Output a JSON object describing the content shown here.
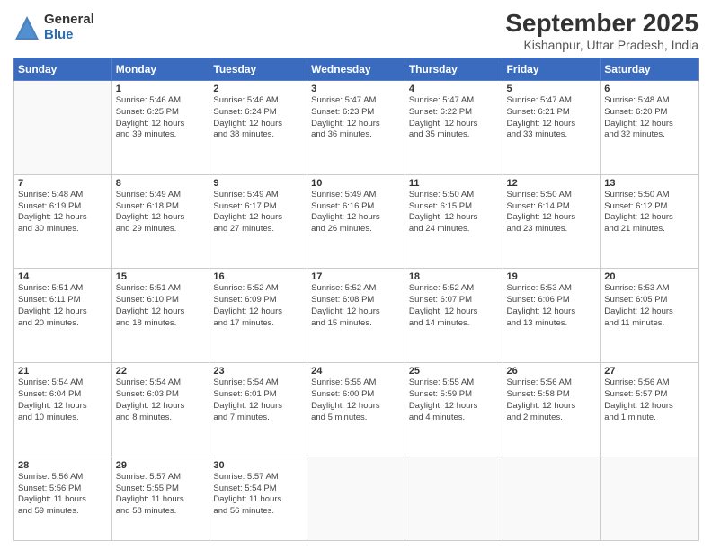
{
  "logo": {
    "general": "General",
    "blue": "Blue"
  },
  "header": {
    "title": "September 2025",
    "subtitle": "Kishanpur, Uttar Pradesh, India"
  },
  "weekdays": [
    "Sunday",
    "Monday",
    "Tuesday",
    "Wednesday",
    "Thursday",
    "Friday",
    "Saturday"
  ],
  "weeks": [
    [
      {
        "day": "",
        "info": ""
      },
      {
        "day": "1",
        "info": "Sunrise: 5:46 AM\nSunset: 6:25 PM\nDaylight: 12 hours\nand 39 minutes."
      },
      {
        "day": "2",
        "info": "Sunrise: 5:46 AM\nSunset: 6:24 PM\nDaylight: 12 hours\nand 38 minutes."
      },
      {
        "day": "3",
        "info": "Sunrise: 5:47 AM\nSunset: 6:23 PM\nDaylight: 12 hours\nand 36 minutes."
      },
      {
        "day": "4",
        "info": "Sunrise: 5:47 AM\nSunset: 6:22 PM\nDaylight: 12 hours\nand 35 minutes."
      },
      {
        "day": "5",
        "info": "Sunrise: 5:47 AM\nSunset: 6:21 PM\nDaylight: 12 hours\nand 33 minutes."
      },
      {
        "day": "6",
        "info": "Sunrise: 5:48 AM\nSunset: 6:20 PM\nDaylight: 12 hours\nand 32 minutes."
      }
    ],
    [
      {
        "day": "7",
        "info": "Sunrise: 5:48 AM\nSunset: 6:19 PM\nDaylight: 12 hours\nand 30 minutes."
      },
      {
        "day": "8",
        "info": "Sunrise: 5:49 AM\nSunset: 6:18 PM\nDaylight: 12 hours\nand 29 minutes."
      },
      {
        "day": "9",
        "info": "Sunrise: 5:49 AM\nSunset: 6:17 PM\nDaylight: 12 hours\nand 27 minutes."
      },
      {
        "day": "10",
        "info": "Sunrise: 5:49 AM\nSunset: 6:16 PM\nDaylight: 12 hours\nand 26 minutes."
      },
      {
        "day": "11",
        "info": "Sunrise: 5:50 AM\nSunset: 6:15 PM\nDaylight: 12 hours\nand 24 minutes."
      },
      {
        "day": "12",
        "info": "Sunrise: 5:50 AM\nSunset: 6:14 PM\nDaylight: 12 hours\nand 23 minutes."
      },
      {
        "day": "13",
        "info": "Sunrise: 5:50 AM\nSunset: 6:12 PM\nDaylight: 12 hours\nand 21 minutes."
      }
    ],
    [
      {
        "day": "14",
        "info": "Sunrise: 5:51 AM\nSunset: 6:11 PM\nDaylight: 12 hours\nand 20 minutes."
      },
      {
        "day": "15",
        "info": "Sunrise: 5:51 AM\nSunset: 6:10 PM\nDaylight: 12 hours\nand 18 minutes."
      },
      {
        "day": "16",
        "info": "Sunrise: 5:52 AM\nSunset: 6:09 PM\nDaylight: 12 hours\nand 17 minutes."
      },
      {
        "day": "17",
        "info": "Sunrise: 5:52 AM\nSunset: 6:08 PM\nDaylight: 12 hours\nand 15 minutes."
      },
      {
        "day": "18",
        "info": "Sunrise: 5:52 AM\nSunset: 6:07 PM\nDaylight: 12 hours\nand 14 minutes."
      },
      {
        "day": "19",
        "info": "Sunrise: 5:53 AM\nSunset: 6:06 PM\nDaylight: 12 hours\nand 13 minutes."
      },
      {
        "day": "20",
        "info": "Sunrise: 5:53 AM\nSunset: 6:05 PM\nDaylight: 12 hours\nand 11 minutes."
      }
    ],
    [
      {
        "day": "21",
        "info": "Sunrise: 5:54 AM\nSunset: 6:04 PM\nDaylight: 12 hours\nand 10 minutes."
      },
      {
        "day": "22",
        "info": "Sunrise: 5:54 AM\nSunset: 6:03 PM\nDaylight: 12 hours\nand 8 minutes."
      },
      {
        "day": "23",
        "info": "Sunrise: 5:54 AM\nSunset: 6:01 PM\nDaylight: 12 hours\nand 7 minutes."
      },
      {
        "day": "24",
        "info": "Sunrise: 5:55 AM\nSunset: 6:00 PM\nDaylight: 12 hours\nand 5 minutes."
      },
      {
        "day": "25",
        "info": "Sunrise: 5:55 AM\nSunset: 5:59 PM\nDaylight: 12 hours\nand 4 minutes."
      },
      {
        "day": "26",
        "info": "Sunrise: 5:56 AM\nSunset: 5:58 PM\nDaylight: 12 hours\nand 2 minutes."
      },
      {
        "day": "27",
        "info": "Sunrise: 5:56 AM\nSunset: 5:57 PM\nDaylight: 12 hours\nand 1 minute."
      }
    ],
    [
      {
        "day": "28",
        "info": "Sunrise: 5:56 AM\nSunset: 5:56 PM\nDaylight: 11 hours\nand 59 minutes."
      },
      {
        "day": "29",
        "info": "Sunrise: 5:57 AM\nSunset: 5:55 PM\nDaylight: 11 hours\nand 58 minutes."
      },
      {
        "day": "30",
        "info": "Sunrise: 5:57 AM\nSunset: 5:54 PM\nDaylight: 11 hours\nand 56 minutes."
      },
      {
        "day": "",
        "info": ""
      },
      {
        "day": "",
        "info": ""
      },
      {
        "day": "",
        "info": ""
      },
      {
        "day": "",
        "info": ""
      }
    ]
  ]
}
